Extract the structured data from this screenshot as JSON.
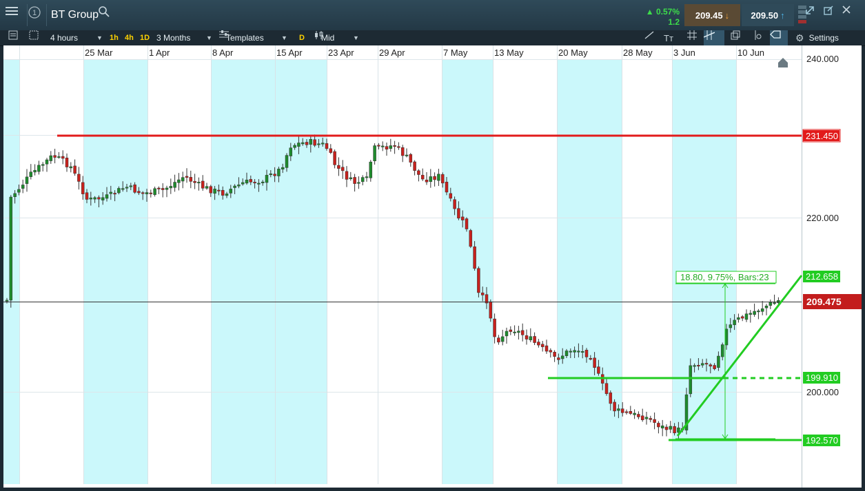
{
  "window": {
    "title": "BT Group",
    "change_pct": "0.57%",
    "change_abs": "1.2",
    "sell_price": "209.45",
    "buy_price": "209.50"
  },
  "toolbar": {
    "interval": "4 hours",
    "quick_1h": "1h",
    "quick_4h": "4h",
    "quick_1d": "1D",
    "range": "3 Months",
    "templates": "Templates",
    "d_flag": "D",
    "price_type": "Mid",
    "settings": "Settings"
  },
  "chart": {
    "date_labels": [
      "25 Mar",
      "1 Apr",
      "8 Apr",
      "15 Apr",
      "23 Apr",
      "29 Apr",
      "7 May",
      "13 May",
      "20 May",
      "28 May",
      "3 Jun",
      "10 Jun"
    ],
    "y_axis_labels": [
      "240.000",
      "220.000",
      "200.000"
    ],
    "resistance_label": "231.450",
    "trend_label": "212.658",
    "current_label": "209.475",
    "support_label": "199.910",
    "low_label": "192.570",
    "measure_text": "18.80, 9.75%, Bars:23",
    "colors": {
      "up": "#1e8b2d",
      "down": "#c8211d",
      "resistance": "#e21b1b",
      "drawing": "#22cc22",
      "current": "#c31d1d",
      "band": "#cbf8fb"
    }
  }
}
